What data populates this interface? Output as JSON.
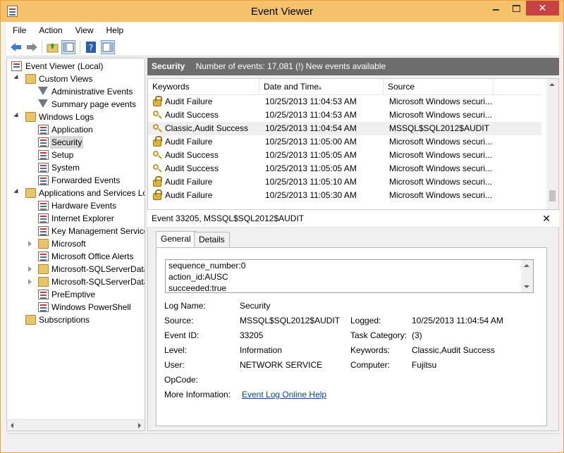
{
  "window": {
    "title": "Event Viewer"
  },
  "menu": {
    "items": [
      "File",
      "Action",
      "View",
      "Help"
    ]
  },
  "tree": {
    "root": "Event Viewer (Local)",
    "custom_views": "Custom Views",
    "administrative_events": "Administrative Events",
    "summary_page_events": "Summary page events",
    "windows_logs": "Windows Logs",
    "application": "Application",
    "security": "Security",
    "setup": "Setup",
    "system": "System",
    "forwarded_events": "Forwarded Events",
    "apps_services": "Applications and Services Lo",
    "hardware_events": "Hardware Events",
    "internet_explorer": "Internet Explorer",
    "key_management": "Key Management Service",
    "microsoft": "Microsoft",
    "office_alerts": "Microsoft Office Alerts",
    "sqlserver1": "Microsoft-SQLServerData",
    "sqlserver2": "Microsoft-SQLServerData",
    "preemptive": "PreEmptive",
    "powershell": "Windows PowerShell",
    "subscriptions": "Subscriptions"
  },
  "log_header": {
    "name": "Security",
    "info": "Number of events: 17,081 (!) New events available"
  },
  "grid": {
    "columns": [
      "Keywords",
      "Date and Time",
      "Source"
    ],
    "rows": [
      {
        "icon": "lock-icon",
        "keywords": "Audit Failure",
        "datetime": "10/25/2013 11:04:53 AM",
        "source": "Microsoft Windows securi..."
      },
      {
        "icon": "key-icon",
        "keywords": "Audit Success",
        "datetime": "10/25/2013 11:04:53 AM",
        "source": "Microsoft Windows securi..."
      },
      {
        "icon": "key-icon",
        "keywords": "Classic,Audit Success",
        "datetime": "10/25/2013 11:04:54 AM",
        "source": "MSSQL$SQL2012$AUDIT"
      },
      {
        "icon": "lock-icon",
        "keywords": "Audit Failure",
        "datetime": "10/25/2013 11:05:00 AM",
        "source": "Microsoft Windows securi..."
      },
      {
        "icon": "key-icon",
        "keywords": "Audit Success",
        "datetime": "10/25/2013 11:05:05 AM",
        "source": "Microsoft Windows securi..."
      },
      {
        "icon": "key-icon",
        "keywords": "Audit Success",
        "datetime": "10/25/2013 11:05:05 AM",
        "source": "Microsoft Windows securi..."
      },
      {
        "icon": "lock-icon",
        "keywords": "Audit Failure",
        "datetime": "10/25/2013 11:05:10 AM",
        "source": "Microsoft Windows securi..."
      },
      {
        "icon": "lock-icon",
        "keywords": "Audit Failure",
        "datetime": "10/25/2013 11:05:30 AM",
        "source": "Microsoft Windows securi..."
      }
    ]
  },
  "detail": {
    "title": "Event 33205, MSSQL$SQL2012$AUDIT",
    "tabs": [
      "General",
      "Details"
    ],
    "xml_lines": [
      "sequence_number:0",
      "action_id:AUSC",
      "succeeded:true"
    ],
    "fields": {
      "log_name_label": "Log Name:",
      "log_name": "Security",
      "source_label": "Source:",
      "source": "MSSQL$SQL2012$AUDIT",
      "logged_label": "Logged:",
      "logged": "10/25/2013 11:04:54 AM",
      "event_id_label": "Event ID:",
      "event_id": "33205",
      "task_category_label": "Task Category:",
      "task_category": "(3)",
      "level_label": "Level:",
      "level": "Information",
      "keywords_label": "Keywords:",
      "keywords": "Classic,Audit Success",
      "user_label": "User:",
      "user": "NETWORK SERVICE",
      "computer_label": "Computer:",
      "computer": "Fujitsu",
      "opcode_label": "OpCode:",
      "opcode": "",
      "more_info_label": "More Information:",
      "more_info_link": "Event Log Online Help"
    }
  },
  "colors": {
    "title_bar": "#f5c16b",
    "close_button": "#c74343",
    "log_header": "#6d6d6d",
    "link": "#0645ad"
  }
}
